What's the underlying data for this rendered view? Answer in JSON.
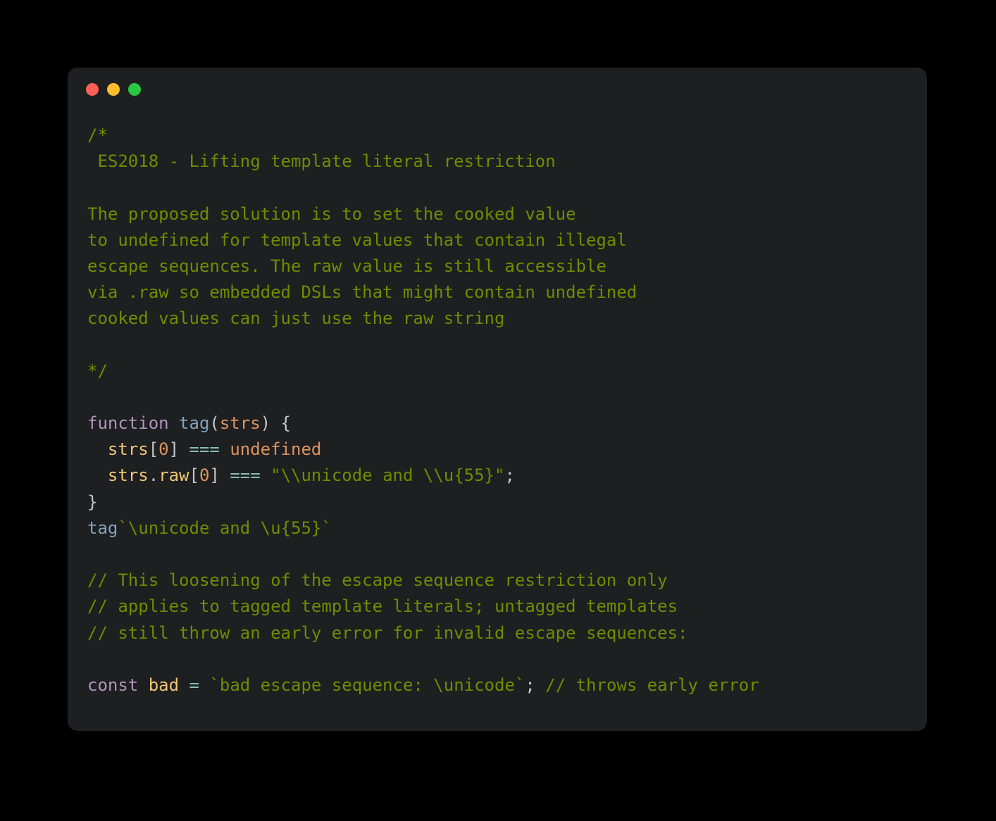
{
  "colors": {
    "traffic_red": "#ff5f56",
    "traffic_yellow": "#ffbd2e",
    "traffic_green": "#27c93f",
    "background": "#1d1f21"
  },
  "code": {
    "block_comment": "/*\n ES2018 - Lifting template literal restriction\n\nThe proposed solution is to set the cooked value\nto undefined for template values that contain illegal\nescape sequences. The raw value is still accessible\nvia .raw so embedded DSLs that might contain undefined\ncooked values can just use the raw string\n\n*/",
    "kw_function": "function",
    "fn_tag_decl": "tag",
    "paren_open": "(",
    "param_strs": "strs",
    "paren_close": ")",
    "brace_open": " {",
    "line_indent": "  ",
    "ident_strs1": "strs",
    "bracket_open1": "[",
    "num_0a": "0",
    "bracket_close1": "]",
    "op_eq1": " === ",
    "undef": "undefined",
    "ident_strs2": "strs",
    "dot": ".",
    "prop_raw": "raw",
    "bracket_open2": "[",
    "num_0b": "0",
    "bracket_close2": "]",
    "op_eq2": " === ",
    "str_raw": "\"\\\\unicode and \\\\u{55}\"",
    "semicolon1": ";",
    "brace_close": "}",
    "call_tag": "tag",
    "tmpl_call": "`\\unicode and \\u{55}`",
    "cmt_l1": "// This loosening of the escape sequence restriction only",
    "cmt_l2": "// applies to tagged template literals; untagged templates",
    "cmt_l3": "// still throw an early error for invalid escape sequences:",
    "kw_const": "const",
    "ident_bad": "bad",
    "op_assign": " = ",
    "tmpl_bad": "`bad escape sequence: \\unicode`",
    "semicolon2": ";",
    "cmt_trail": " // throws early error"
  }
}
